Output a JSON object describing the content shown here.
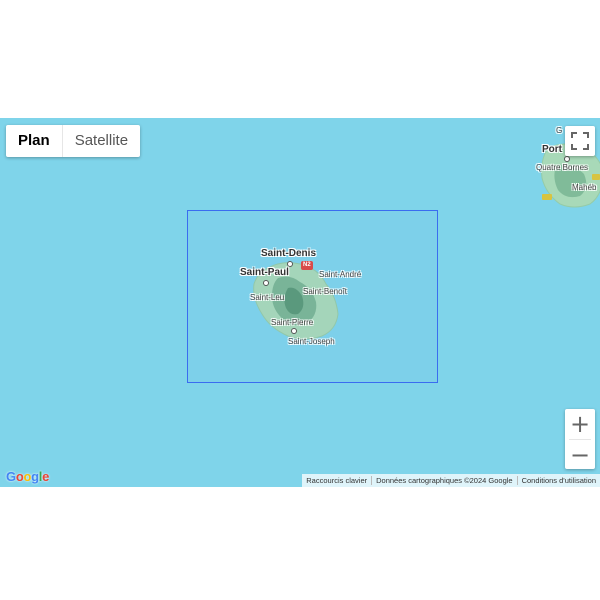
{
  "map_type": {
    "plan_label": "Plan",
    "satellite_label": "Satellite",
    "selected": "Plan"
  },
  "controls": {
    "fullscreen_icon": "fullscreen-icon",
    "zoom_in_label": "+",
    "zoom_out_label": "−"
  },
  "places": {
    "saint_denis": "Saint-Denis",
    "saint_paul": "Saint-Paul",
    "saint_andre": "Saint-André",
    "saint_benoit": "Saint-Benoît",
    "saint_leu": "Saint-Leu",
    "saint_pierre": "Saint-Pierre",
    "saint_joseph": "Saint-Joseph",
    "road_n2": "N2",
    "port_louis": "Port",
    "port_louis_top": "G",
    "quatre_bornes": "Quatre Bornes",
    "mahebourg": "Mahéb"
  },
  "logo": {
    "text": "Google",
    "letters": [
      "G",
      "o",
      "o",
      "g",
      "l",
      "e"
    ],
    "colors": [
      "#4285F4",
      "#EA4335",
      "#FBBC05",
      "#4285F4",
      "#34A853",
      "#EA4335"
    ]
  },
  "attribution": {
    "shortcuts": "Raccourcis clavier",
    "data": "Données cartographiques ©2024 Google",
    "terms": "Conditions d'utilisation"
  },
  "colors": {
    "ocean": "#7fd4ea",
    "land": "#a8d9b8",
    "forest": "#6fae8c",
    "bbox": "#3a6cf0"
  }
}
